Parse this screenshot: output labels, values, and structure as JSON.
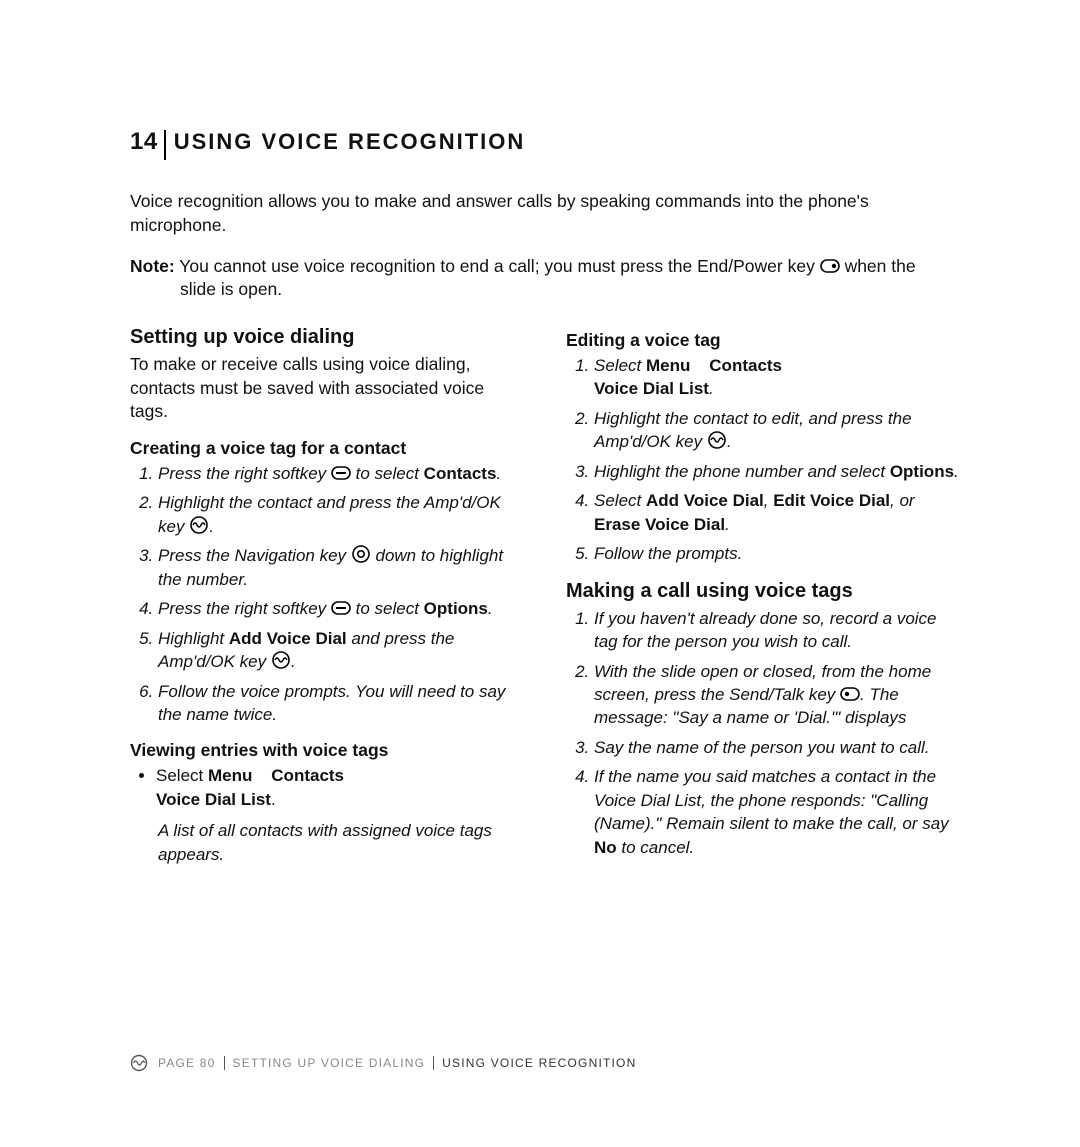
{
  "chapter": {
    "number": "14",
    "title": "USING VOICE RECOGNITION"
  },
  "intro": "Voice recognition allows you to make and answer calls by speaking commands into the phone's microphone.",
  "note": {
    "label": "Note:",
    "text_before_icon": " You cannot use voice recognition to end a call; you must press the End/Power key ",
    "text_after_icon": " when the",
    "line2": "slide is open."
  },
  "left": {
    "heading": "Setting up voice dialing",
    "lead": "To make or receive calls using voice dialing, contacts must be saved with associated voice tags.",
    "createTag": {
      "heading": "Creating a voice tag for a contact",
      "s1a": "Press the right softkey ",
      "s1b": " to select ",
      "s1c": "Contacts",
      "s2a": "Highlight the contact and press the Amp'd/OK key ",
      "s3a": "Press the Navigation key ",
      "s3b": " down to highlight the number.",
      "s4a": "Press the right softkey ",
      "s4b": " to select ",
      "s4c": "Options",
      "s5a": "Highlight ",
      "s5b": "Add Voice Dial",
      "s5c": " and press the Amp'd/OK key ",
      "s6": "Follow the voice prompts. You will need to say the name twice."
    },
    "viewTags": {
      "heading": "Viewing entries with voice tags",
      "bullet_a": "Select ",
      "bullet_b": "Menu",
      "bullet_c": "Contacts",
      "bullet_d": "Voice Dial List",
      "note": "A list of all contacts with assigned voice tags appears."
    }
  },
  "right": {
    "editTag": {
      "heading": "Editing a voice tag",
      "s1a": "Select ",
      "s1b": "Menu",
      "s1c": "Contacts",
      "s1d": "Voice Dial List",
      "s2a": "Highlight the contact to edit, and press the Amp'd/OK key ",
      "s3a": "Highlight the phone number and select ",
      "s3b": "Options",
      "s4a": "Select ",
      "s4b": "Add Voice Dial",
      "s4c": ", ",
      "s4d": "Edit Voice Dial",
      "s4e": ", or ",
      "s4f": "Erase Voice Dial",
      "s5": "Follow the prompts."
    },
    "makeCall": {
      "heading": "Making a call using voice tags",
      "s1": "If you haven't already done so, record a voice tag for the person you wish to call.",
      "s2a": "With the slide open or closed, from the home screen, press the Send/Talk key ",
      "s2b": ". The message: \"Say a name or 'Dial.'\" displays",
      "s3": "Say the name of the person you want to call.",
      "s4a": "If the name you said matches a contact in the Voice Dial List, the phone responds: \"Calling (Name).\" Remain silent to make the call, or say ",
      "s4b": "No",
      "s4c": " to cancel."
    }
  },
  "footer": {
    "page": "PAGE 80",
    "crumb1": "SETTING UP VOICE DIALING",
    "crumb2": "USING VOICE RECOGNITION"
  }
}
